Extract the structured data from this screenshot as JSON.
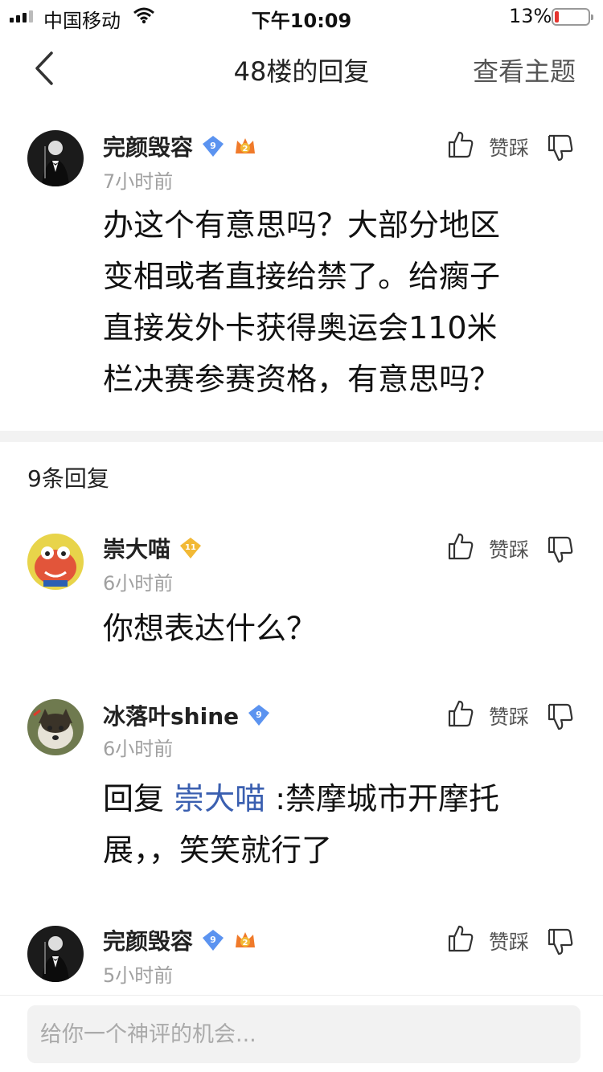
{
  "status_bar": {
    "carrier": "中国移动",
    "time": "下午10:09",
    "battery_percent_text": "13%",
    "battery_level": 0.13,
    "battery_color": "#e5342f"
  },
  "nav": {
    "back_icon": "chevron-left-icon",
    "title": "48楼的回复",
    "right_action": "查看主题"
  },
  "main_post": {
    "username": "完颜毁容",
    "level_badge": "9",
    "rank_badge": "2",
    "time": "7小时前",
    "vote_label": "赞踩",
    "lines": [
      "办这个有意思吗？大部分地区",
      "变相或者直接给禁了。给瘸子",
      "直接发外卡获得奥运会110米",
      "栏决赛参赛资格，有意思吗？"
    ]
  },
  "reply_count": "9条回复",
  "replies": [
    {
      "username": "崇大喵",
      "level_badge": "11",
      "time": "6小时前",
      "vote_label": "赞踩",
      "text": "你想表达什么？"
    },
    {
      "username": "冰落叶shine",
      "level_badge": "9",
      "time": "6小时前",
      "vote_label": "赞踩",
      "reply_prefix": "回复 ",
      "mention": "崇大喵",
      "text_line1": " :禁摩城市开摩托",
      "text_line2": "展，，笑笑就行了"
    },
    {
      "username": "完颜毁容",
      "level_badge": "9",
      "rank_badge": "2",
      "time": "5小时前",
      "vote_label": "赞踩"
    }
  ],
  "input": {
    "placeholder": "给你一个神评的机会..."
  },
  "colors": {
    "mention": "#3a5fb0",
    "time_gray": "#a0a0a0",
    "badge_blue": "#5b93f0",
    "badge_gold": "#f2b935",
    "badge_orange": "#f07a2a"
  }
}
